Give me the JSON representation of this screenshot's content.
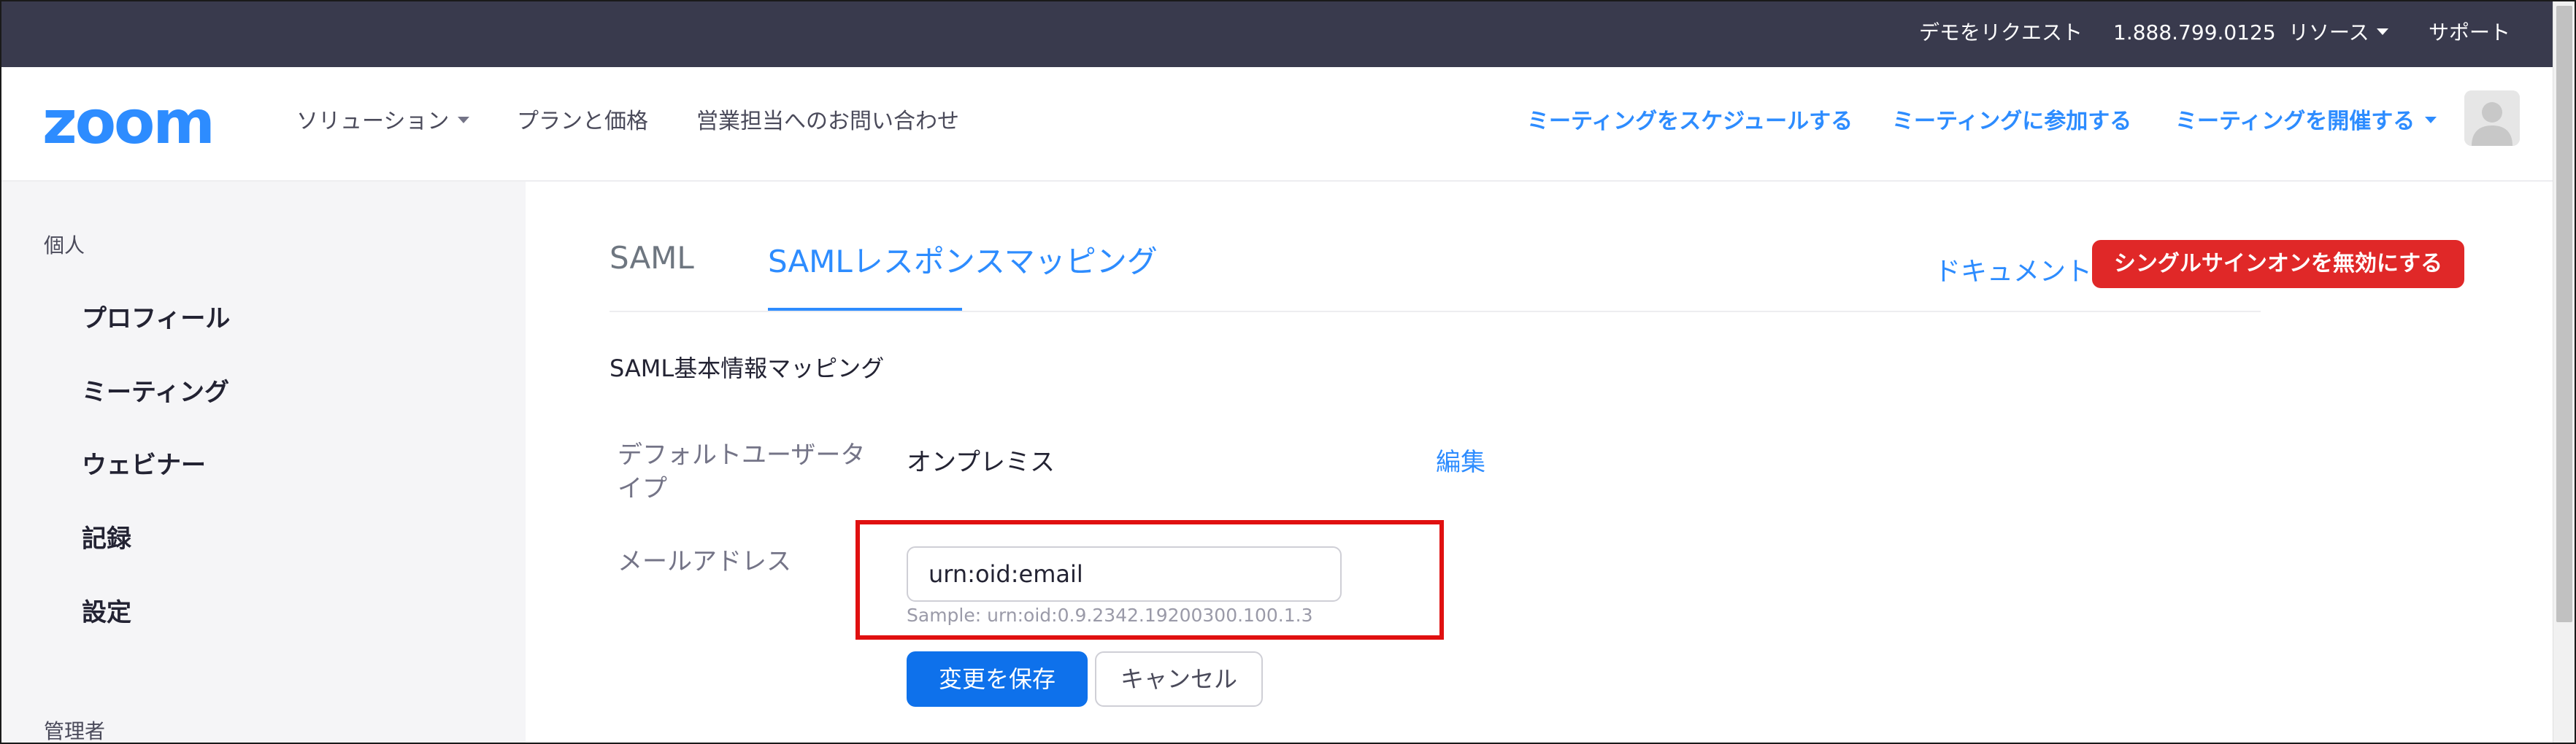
{
  "topbar": {
    "request_demo": "デモをリクエスト",
    "phone": "1.888.799.0125",
    "resources": "リソース",
    "support": "サポート"
  },
  "nav": {
    "logo": "zoom",
    "solutions": "ソリューション",
    "plans": "プランと価格",
    "contact_sales": "営業担当へのお問い合わせ",
    "schedule": "ミーティングをスケジュールする",
    "join": "ミーティングに参加する",
    "host": "ミーティングを開催する"
  },
  "sidebar": {
    "personal_header": "個人",
    "items": [
      {
        "label": "プロフィール"
      },
      {
        "label": "ミーティング"
      },
      {
        "label": "ウェビナー"
      },
      {
        "label": "記録"
      },
      {
        "label": "設定"
      }
    ],
    "admin_header": "管理者"
  },
  "tabs": [
    {
      "label": "SAML",
      "active": false
    },
    {
      "label": "SAMLレスポンスマッピング",
      "active": true
    }
  ],
  "actions": {
    "docs": "ドキュメント",
    "disable_sso": "シングルサインオンを無効にする"
  },
  "section": {
    "title": "SAML基本情報マッピング"
  },
  "fields": {
    "user_type_label_line1": "デフォルトユーザータ",
    "user_type_label_line2": "イプ",
    "user_type_value": "オンプレミス",
    "edit": "編集",
    "email_label": "メールアドレス",
    "email_value": "urn:oid:email",
    "email_sample": "Sample: urn:oid:0.9.2342.19200300.100.1.3"
  },
  "buttons": {
    "save": "変更を保存",
    "cancel": "キャンセル"
  },
  "colors": {
    "topbar": "#393a4d",
    "accent": "#2D8CFF",
    "danger": "#e02828",
    "highlight": "#e01010",
    "primary_button": "#0e71eb"
  }
}
